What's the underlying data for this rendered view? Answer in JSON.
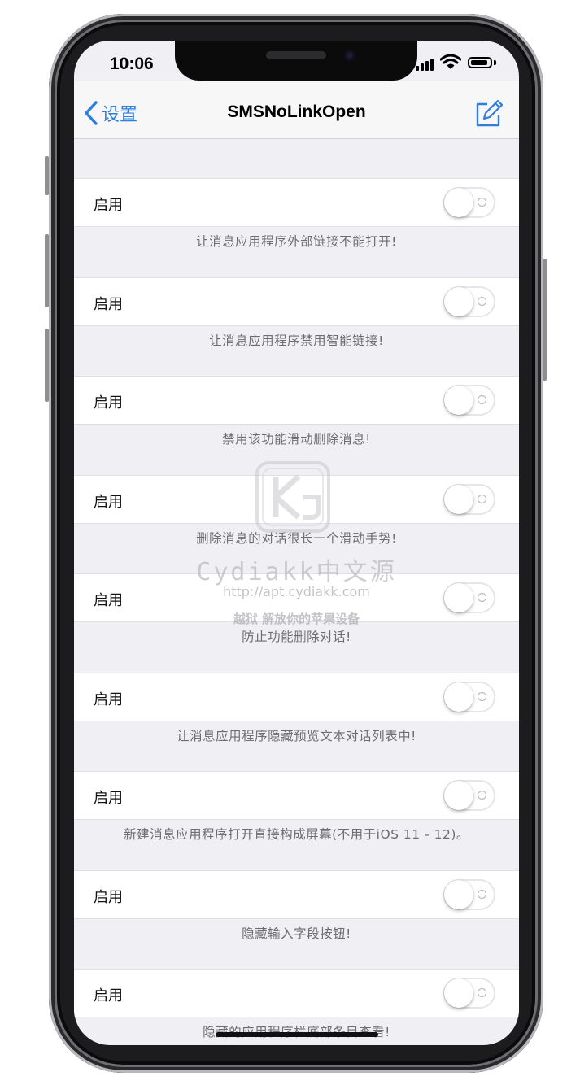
{
  "status_bar": {
    "time": "10:06"
  },
  "nav": {
    "back_label": "设置",
    "title": "SMSNoLinkOpen"
  },
  "settings": [
    {
      "label": "启用",
      "enabled": false,
      "footer": "让消息应用程序外部链接不能打开!"
    },
    {
      "label": "启用",
      "enabled": false,
      "footer": "让消息应用程序禁用智能链接!"
    },
    {
      "label": "启用",
      "enabled": false,
      "footer": "禁用该功能滑动删除消息!"
    },
    {
      "label": "启用",
      "enabled": false,
      "footer": "删除消息的对话很长一个滑动手势!"
    },
    {
      "label": "启用",
      "enabled": false,
      "footer": "防止功能删除对话!"
    },
    {
      "label": "启用",
      "enabled": false,
      "footer": "让消息应用程序隐藏预览文本对话列表中!"
    },
    {
      "label": "启用",
      "enabled": false,
      "footer": "新建消息应用程序打开直接构成屏幕(不用于iOS 11 - 12)。"
    },
    {
      "label": "启用",
      "enabled": false,
      "footer": "隐藏输入字段按钮!"
    },
    {
      "label": "启用",
      "enabled": false,
      "footer": "隐藏的应用程序栏底部条目查看!"
    }
  ],
  "watermark": {
    "name": "Cydiakk中文源",
    "url": "http://apt.cydiakk.com",
    "slogan": "越狱 解放你的苹果设备"
  },
  "colors": {
    "accent": "#2f7de1",
    "background": "#efeff4",
    "footer_text": "#6d6d72"
  },
  "icons": {
    "back": "chevron-left-icon",
    "compose": "compose-icon",
    "wifi": "wifi-icon",
    "battery": "battery-icon",
    "signal": "signal-icon"
  }
}
